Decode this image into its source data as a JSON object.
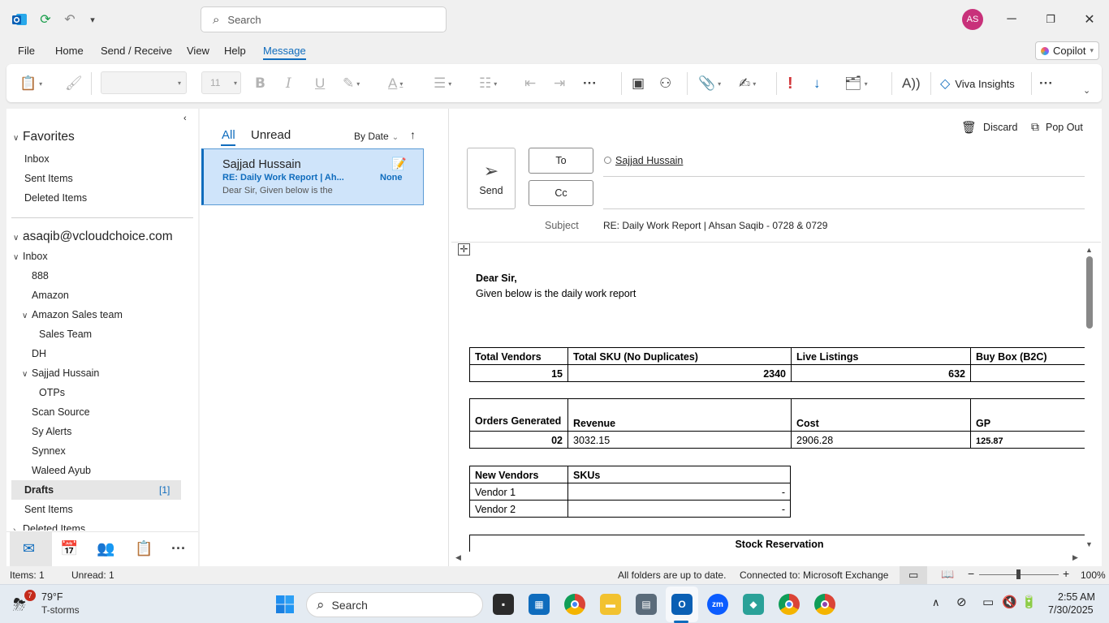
{
  "titlebar": {
    "search_placeholder": "Search",
    "avatar_initials": "AS"
  },
  "menu": {
    "items": [
      "File",
      "Home",
      "Send / Receive",
      "View",
      "Help",
      "Message"
    ],
    "active": "Message",
    "copilot_label": "Copilot"
  },
  "ribbon": {
    "font_size": "11",
    "viva_label": "Viva Insights"
  },
  "folders": {
    "favorites_header": "Favorites",
    "favorites": [
      "Inbox",
      "Sent Items",
      "Deleted Items"
    ],
    "account": "asaqib@vcloudchoice.com",
    "inbox": "Inbox",
    "inbox_children": {
      "f888": "888",
      "amazon": "Amazon",
      "amazon_sales_team": "Amazon Sales team",
      "sales_team": "Sales Team",
      "dh": "DH",
      "sajjad_hussain": "Sajjad Hussain",
      "otps": "OTPs",
      "scan_source": "Scan Source",
      "sy_alerts": "Sy Alerts",
      "synnex": "Synnex",
      "waleed_ayub": "Waleed Ayub"
    },
    "drafts": "Drafts",
    "drafts_count": "[1]",
    "sent_items": "Sent Items",
    "deleted_items_partial": "Deleted Items"
  },
  "message_list": {
    "tab_all": "All",
    "tab_unread": "Unread",
    "sort_label": "By Date",
    "item": {
      "sender": "Sajjad Hussain",
      "subject": "RE: Daily Work Report | Ah...",
      "preview": "Dear Sir,  Given below is the",
      "flag": "None"
    }
  },
  "compose": {
    "discard_label": "Discard",
    "popout_label": "Pop Out",
    "send_label": "Send",
    "to_label": "To",
    "cc_label": "Cc",
    "to_recipient": "Sajjad Hussain",
    "subject_label": "Subject",
    "subject_value": "RE: Daily Work Report | Ahsan Saqib - 0728 & 0729",
    "body": {
      "greeting": "Dear Sir,",
      "intro": "Given below is the daily work report",
      "table1": {
        "h1": "Total Vendors",
        "h2": "Total SKU (No Duplicates)",
        "h3": "Live Listings",
        "h4": "Buy Box (B2C)",
        "v1": "15",
        "v2": "2340",
        "v3": "632",
        "v4": ""
      },
      "table2": {
        "h1": "Orders Generated",
        "h2": "Revenue",
        "h3": "Cost",
        "h4": "GP",
        "v1": "02",
        "v2": "3032.15",
        "v3": "2906.28",
        "v4": "125.87"
      },
      "table3": {
        "h1": "New Vendors",
        "h2": "SKUs",
        "r1c1": "Vendor 1",
        "r1c2": "-",
        "r2c1": "Vendor 2",
        "r2c2": "-"
      },
      "table4_header": "Stock Reservation"
    }
  },
  "statusbar": {
    "items": "Items: 1",
    "unread": "Unread: 1",
    "sync": "All folders are up to date.",
    "connection": "Connected to: Microsoft Exchange",
    "zoom": "100%"
  },
  "taskbar": {
    "weather_badge": "7",
    "temp": "79°F",
    "condition": "T-storms",
    "search_placeholder": "Search",
    "zoom_app": "zm",
    "time": "2:55 AM",
    "date": "7/30/2025"
  },
  "colors": {
    "accent": "#0f6cbd",
    "selected_bg": "#cfe4fa",
    "avatar": "#c8317a",
    "importance_red": "#d13438"
  }
}
